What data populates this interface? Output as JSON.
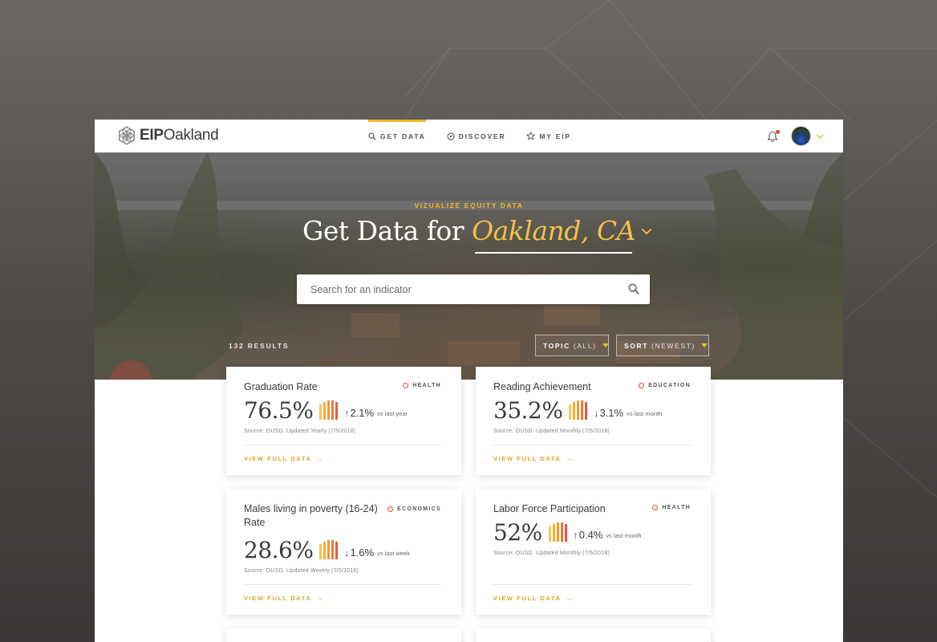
{
  "brand": {
    "name_bold": "EIP",
    "name_light": "Oakland"
  },
  "nav": {
    "items": [
      {
        "label": "GET DATA",
        "icon": "search-icon",
        "active": true
      },
      {
        "label": "DISCOVER",
        "icon": "compass-icon",
        "active": false
      },
      {
        "label": "MY EIP",
        "icon": "star-icon",
        "active": false
      }
    ]
  },
  "user": {
    "notification_icon": "bell-icon",
    "has_notification": true
  },
  "hero": {
    "eyebrow": "VIZUALIZE EQUITY DATA",
    "title_prefix": "Get Data for ",
    "city": "Oakland, CA",
    "search_placeholder": "Search for an indicator"
  },
  "results": {
    "count_label": "132 RESULTS",
    "topic_label": "TOPIC",
    "topic_value": "(ALL)",
    "sort_label": "SORT",
    "sort_value": "(NEWEST)"
  },
  "cards": [
    {
      "title": "Graduation Rate",
      "tag": "HEALTH",
      "value": "76.5%",
      "direction": "up",
      "arrow": "↑",
      "change": "2.1%",
      "comparison": "vs last year",
      "source": "Source: OUSD.  Updated Yearly (7/5/2018)",
      "cta": "VIEW FULL DATA",
      "cta_arrow": "→"
    },
    {
      "title": "Reading Achievement",
      "tag": "EDUCATION",
      "value": "35.2%",
      "direction": "down",
      "arrow": "↓",
      "change": "3.1%",
      "comparison": "vs last month",
      "source": "Source: OUSD.  Updated Monthly (7/5/2018)",
      "cta": "VIEW FULL DATA",
      "cta_arrow": "→"
    },
    {
      "title": "Males living in poverty (16-24) Rate",
      "tag": "ECONOMICS",
      "value": "28.6%",
      "direction": "down",
      "arrow": "↓",
      "change": "1.6%",
      "comparison": "vs last week",
      "source": "Source: OUSD.  Updated Weekly (7/5/2018)",
      "cta": "VIEW FULL DATA",
      "cta_arrow": "→"
    },
    {
      "title": "Labor Force Participation",
      "tag": "HEALTH",
      "value": "52%",
      "direction": "up",
      "arrow": "↑",
      "change": "0.4%",
      "comparison": "vs last month",
      "source": "Source: OUSD.  Updated Monthly (7/5/2018)",
      "cta": "VIEW FULL DATA",
      "cta_arrow": "→"
    }
  ],
  "colors": {
    "accent": "#f2b72a",
    "tag_dot": "#e04a3f",
    "spark": [
      "#f6c64a",
      "#f2b12e",
      "#f09a2a",
      "#ec7b35",
      "#e45a44"
    ]
  }
}
